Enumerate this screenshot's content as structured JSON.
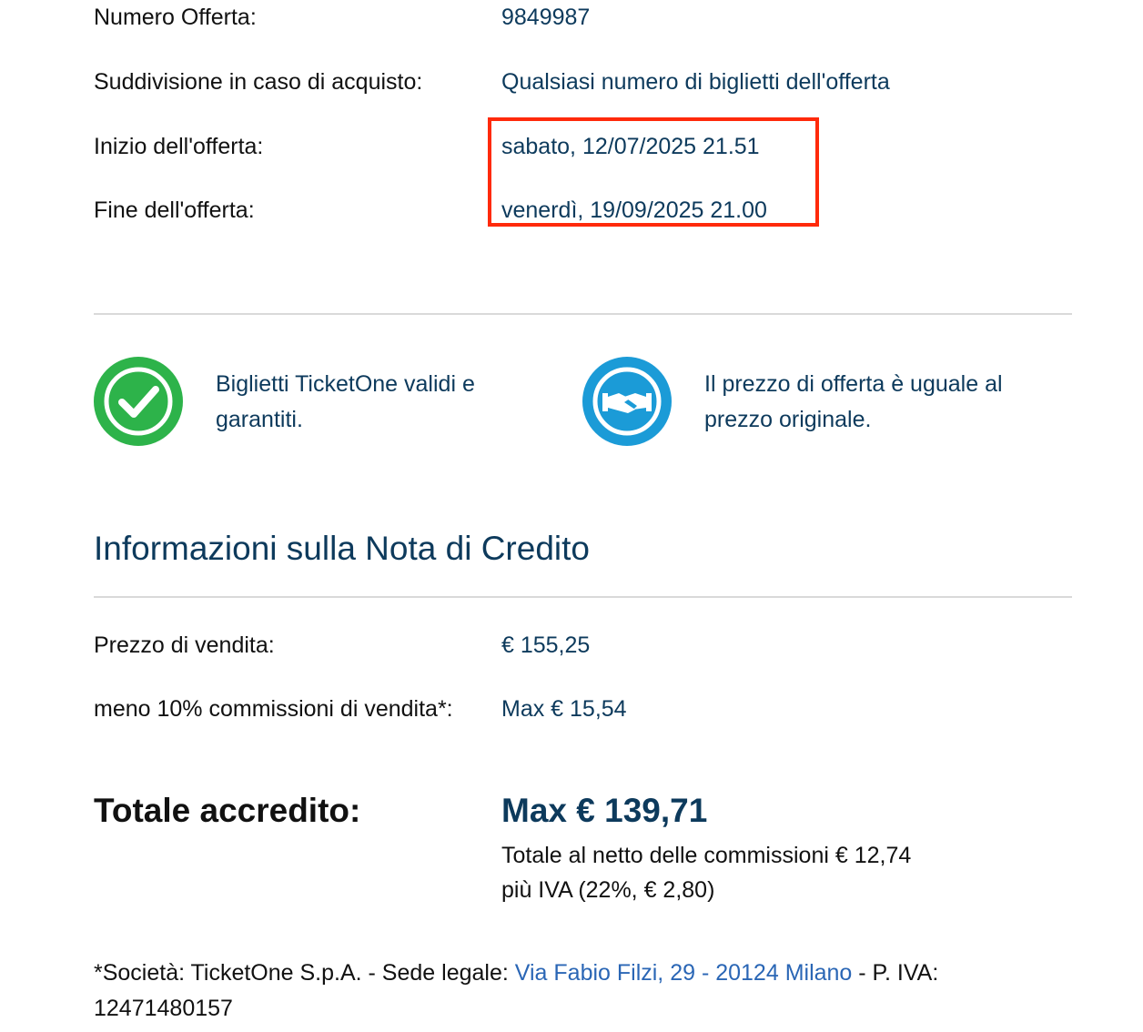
{
  "offer": {
    "rows": [
      {
        "label": "Numero Offerta:",
        "value": "9849987"
      },
      {
        "label": "Suddivisione in caso di acquisto:",
        "value": "Qualsiasi numero di biglietti dell'offerta"
      },
      {
        "label": "Inizio dell'offerta:",
        "value": "sabato, 12/07/2025 21.51"
      },
      {
        "label": "Fine dell'offerta:",
        "value": "venerdì, 19/09/2025 21.00"
      }
    ],
    "highlight_color": "#ff2a0b"
  },
  "features": [
    {
      "icon": "checkmark-badge-icon",
      "color": "#2db34a",
      "text_line1": "Biglietti TicketOne validi e",
      "text_line2": "garantiti."
    },
    {
      "icon": "handshake-badge-icon",
      "color": "#1b9bd7",
      "text_line1": "Il prezzo di offerta è uguale al",
      "text_line2": "prezzo originale."
    }
  ],
  "credit": {
    "title": "Informazioni sulla Nota di Credito",
    "rows": [
      {
        "label": "Prezzo di vendita:",
        "value": "€ 155,25"
      },
      {
        "label": "meno 10% commissioni di vendita*:",
        "value": "Max € 15,54"
      }
    ],
    "total_label": "Totale accredito:",
    "total_value": "Max € 139,71",
    "note_line1": "Totale al netto delle commissioni € 12,74",
    "note_line2": "più IVA (22%, € 2,80)"
  },
  "footer": {
    "prefix": "*Società: TicketOne S.p.A. - Sede legale: ",
    "address_link": "Via Fabio Filzi, 29 - 20124 Milano",
    "suffix": " - P. IVA:",
    "vat_number": "12471480157"
  },
  "colors": {
    "text": "#111111",
    "accent_dark_blue": "#0d3a5c",
    "link_blue": "#2a66b5",
    "divider": "#d9d9d9"
  }
}
